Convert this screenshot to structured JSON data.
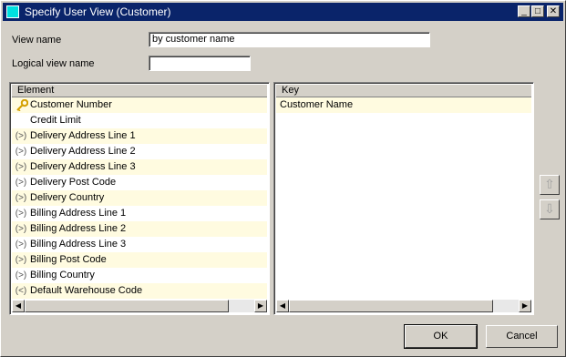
{
  "window": {
    "title": "Specify User View (Customer)",
    "controls": {
      "minimize": "_",
      "maximize": "□",
      "close": "✕"
    }
  },
  "form": {
    "view_name_label": "View name",
    "view_name_value": "by customer name",
    "logical_view_name_label": "Logical view name",
    "logical_view_name_value": ""
  },
  "element_panel": {
    "header": "Element",
    "rows": [
      {
        "label": "Customer Number",
        "icon": "key-icon",
        "glyph": ""
      },
      {
        "label": "Credit Limit",
        "icon": "none",
        "glyph": ""
      },
      {
        "label": "Delivery Address Line 1",
        "icon": "paren-icon",
        "glyph": "(>)"
      },
      {
        "label": "Delivery Address Line 2",
        "icon": "paren-icon",
        "glyph": "(>)"
      },
      {
        "label": "Delivery Address Line 3",
        "icon": "paren-icon",
        "glyph": "(>)"
      },
      {
        "label": "Delivery Post Code",
        "icon": "paren-icon",
        "glyph": "(>)"
      },
      {
        "label": "Delivery Country",
        "icon": "paren-icon",
        "glyph": "(>)"
      },
      {
        "label": "Billing Address Line 1",
        "icon": "paren-icon",
        "glyph": "(>)"
      },
      {
        "label": "Billing Address Line 2",
        "icon": "paren-icon",
        "glyph": "(>)"
      },
      {
        "label": "Billing Address Line 3",
        "icon": "paren-icon",
        "glyph": "(>)"
      },
      {
        "label": "Billing Post Code",
        "icon": "paren-icon",
        "glyph": "(>)"
      },
      {
        "label": "Billing Country",
        "icon": "paren-icon",
        "glyph": "(>)"
      },
      {
        "label": "Default Warehouse Code",
        "icon": "paren-icon",
        "glyph": "(<)"
      }
    ]
  },
  "key_panel": {
    "header": "Key",
    "rows": [
      {
        "label": "Customer Name"
      }
    ]
  },
  "side_buttons": {
    "up": "⇧",
    "down": "⇩"
  },
  "buttons": {
    "ok": "OK",
    "cancel": "Cancel"
  },
  "colors": {
    "title_bar": "#0a246a",
    "row_highlight": "#fffbe0",
    "face": "#d4d0c8"
  }
}
